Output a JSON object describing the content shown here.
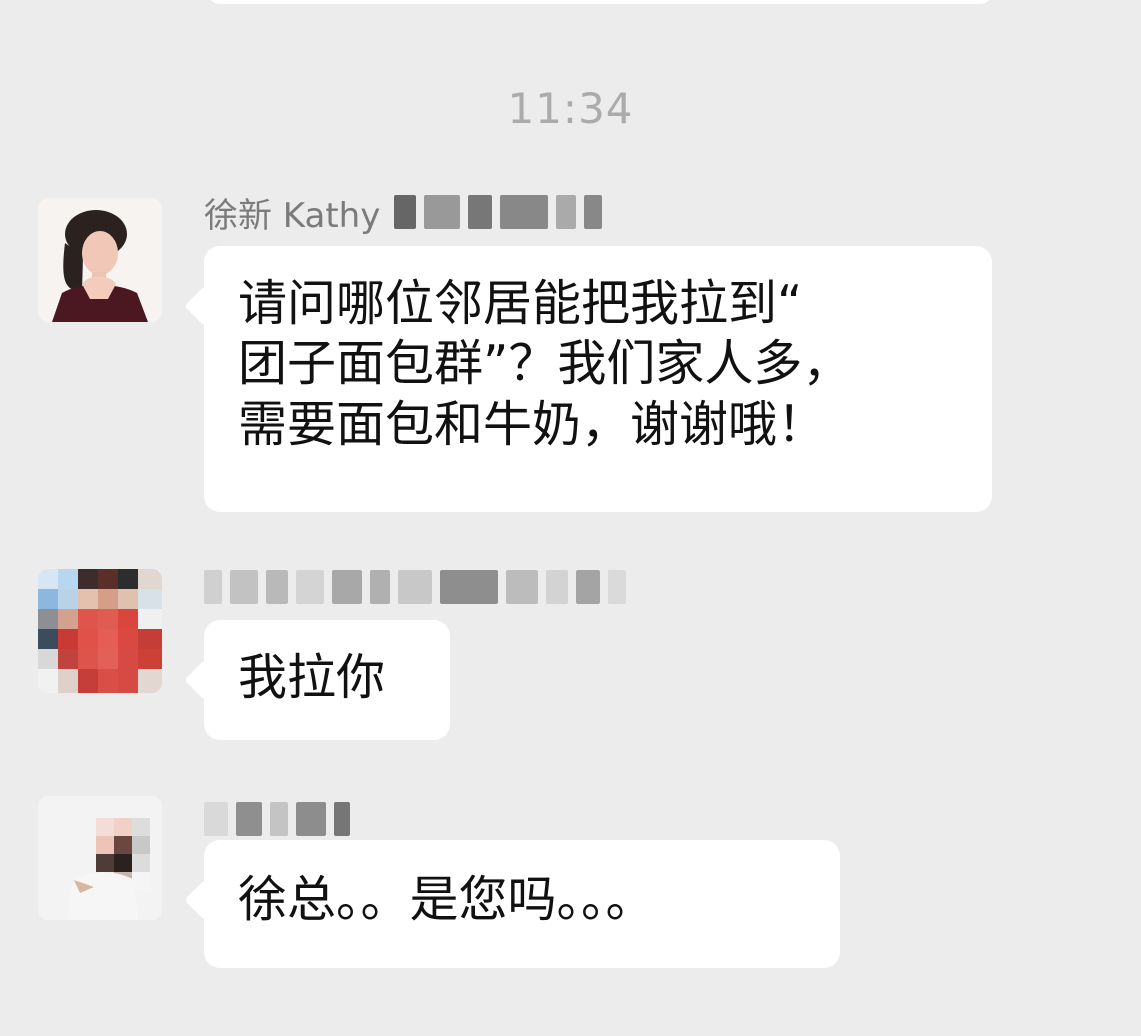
{
  "timestamp": "11:34",
  "messages": [
    {
      "sender": "徐新 Kathy",
      "text": "请问哪位邻居能把我拉到“\n团子面包群”？我们家人多，\n需要面包和牛奶，谢谢哦！",
      "avatar_icon": "woman-portrait-avatar"
    },
    {
      "sender": "",
      "text": "我拉你",
      "avatar_icon": "pixelated-red-dress-avatar"
    },
    {
      "sender": "",
      "text": "徐总。。是您吗。。。",
      "avatar_icon": "pixelated-girl-avatar"
    }
  ],
  "colors": {
    "background": "#ececec",
    "bubble": "#ffffff",
    "timestamp": "#ababab",
    "sender": "#7b7b7b"
  }
}
